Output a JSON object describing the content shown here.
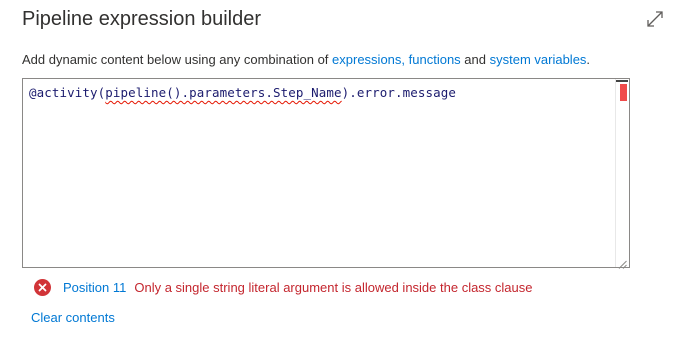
{
  "dialog": {
    "title": "Pipeline expression builder",
    "expand_icon": "expand-diagonal-icon"
  },
  "description": {
    "prefix": "Add dynamic content below using any combination of ",
    "link_expressions": "expressions,",
    "link_functions": "functions",
    "middle": " and ",
    "link_system_variables": "system variables",
    "suffix": "."
  },
  "editor": {
    "code_prefix": "@activity(",
    "code_squiggled": "pipeline().parameters.Step_Name",
    "code_suffix": ").error.message"
  },
  "error": {
    "icon": "error-x-icon",
    "position_label": "Position 11",
    "message": "Only a single string literal argument is allowed inside the class clause",
    "color": "#d13438"
  },
  "actions": {
    "clear_label": "Clear contents"
  },
  "colors": {
    "accent": "#0078d4",
    "error": "#d13438"
  }
}
